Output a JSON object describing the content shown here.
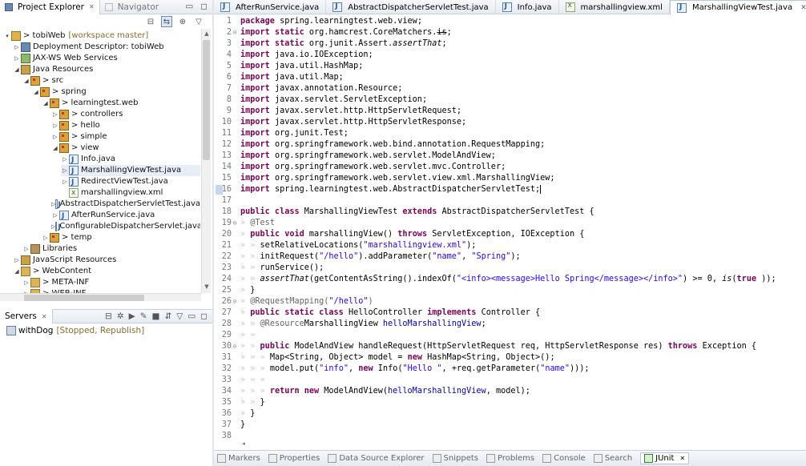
{
  "left_panel": {
    "tabs": [
      {
        "label": "Project Explorer",
        "close": "✕",
        "active": true
      },
      {
        "label": "Navigator",
        "active": false
      }
    ]
  },
  "tree": [
    {
      "depth": 0,
      "arrow": "▾",
      "icon": "proj",
      "label": "> tobiWeb",
      "suffix": "[workspace master]"
    },
    {
      "depth": 1,
      "arrow": "▷",
      "icon": "dd",
      "label": "Deployment Descriptor: tobiWeb"
    },
    {
      "depth": 1,
      "arrow": "▷",
      "icon": "ws",
      "label": "JAX-WS Web Services"
    },
    {
      "depth": 1,
      "arrow": "◢",
      "icon": "src",
      "label": "Java Resources"
    },
    {
      "depth": 2,
      "arrow": "◢",
      "icon": "pkg",
      "label": "> src"
    },
    {
      "depth": 3,
      "arrow": "◢",
      "icon": "pkg",
      "label": "> spring"
    },
    {
      "depth": 4,
      "arrow": "◢",
      "icon": "pkg",
      "label": "> learningtest.web"
    },
    {
      "depth": 5,
      "arrow": "▷",
      "icon": "pkg",
      "label": "> controllers"
    },
    {
      "depth": 5,
      "arrow": "▷",
      "icon": "pkg",
      "label": "> hello"
    },
    {
      "depth": 5,
      "arrow": "▷",
      "icon": "pkg",
      "label": "> simple"
    },
    {
      "depth": 5,
      "arrow": "◢",
      "icon": "pkg",
      "label": "> view"
    },
    {
      "depth": 6,
      "arrow": "▷",
      "icon": "java",
      "label": "Info.java"
    },
    {
      "depth": 6,
      "arrow": "▷",
      "icon": "java",
      "label": "MarshallingViewTest.java",
      "selected": true
    },
    {
      "depth": 6,
      "arrow": "▷",
      "icon": "java",
      "label": "RedirectViewTest.java"
    },
    {
      "depth": 6,
      "arrow": "",
      "icon": "xml",
      "label": "marshallingview.xml"
    },
    {
      "depth": 5,
      "arrow": "▷",
      "icon": "java",
      "label": "AbstractDispatcherServletTest.java"
    },
    {
      "depth": 5,
      "arrow": "▷",
      "icon": "java",
      "label": "AfterRunService.java"
    },
    {
      "depth": 5,
      "arrow": "▷",
      "icon": "java",
      "label": "ConfigurableDispatcherServlet.java"
    },
    {
      "depth": 4,
      "arrow": "▷",
      "icon": "pkg",
      "label": "> temp"
    },
    {
      "depth": 2,
      "arrow": "▷",
      "icon": "lib",
      "label": "Libraries"
    },
    {
      "depth": 1,
      "arrow": "▷",
      "icon": "js",
      "label": "JavaScript Resources"
    },
    {
      "depth": 1,
      "arrow": "◢",
      "icon": "web",
      "label": "> WebContent"
    },
    {
      "depth": 2,
      "arrow": "▷",
      "icon": "web",
      "label": "> META-INF"
    },
    {
      "depth": 2,
      "arrow": "▷",
      "icon": "web",
      "label": "> WEB-INF"
    }
  ],
  "servers_panel": {
    "tab": {
      "label": "Servers",
      "close": "✕"
    },
    "servers": [
      {
        "name": "withDog",
        "status": "[Stopped, Republish]"
      }
    ]
  },
  "editor_tabs": [
    {
      "label": "AfterRunService.java",
      "icon": "java",
      "active": false
    },
    {
      "label": "AbstractDispatcherServletTest.java",
      "icon": "java",
      "active": false
    },
    {
      "label": "Info.java",
      "icon": "java",
      "active": false
    },
    {
      "label": "marshallingview.xml",
      "icon": "xml",
      "active": false
    },
    {
      "label": "MarshallingViewTest.java",
      "icon": "java",
      "active": true,
      "close": "✕"
    }
  ],
  "code": [
    {
      "n": "1",
      "segs": [
        [
          "kw",
          "package"
        ],
        [
          "",
          "spring.learningtest.web.view;"
        ]
      ]
    },
    {
      "n": "2",
      "fold": "⊖",
      "segs": [
        [
          "kw",
          "import static"
        ],
        [
          "",
          "org.hamcrest.CoreMatchers."
        ],
        [
          "strike",
          "is"
        ],
        [
          "",
          ";"
        ]
      ]
    },
    {
      "n": "3",
      "segs": [
        [
          "kw",
          "import static"
        ],
        [
          "",
          "org.junit.Assert."
        ],
        [
          "ital",
          "assertThat"
        ],
        [
          "",
          ";"
        ]
      ]
    },
    {
      "n": "4",
      "segs": [
        [
          "kw",
          "import"
        ],
        [
          "",
          "java.io.IOException;"
        ]
      ]
    },
    {
      "n": "5",
      "segs": [
        [
          "kw",
          "import"
        ],
        [
          "",
          "java.util.HashMap;"
        ]
      ]
    },
    {
      "n": "6",
      "segs": [
        [
          "kw",
          "import"
        ],
        [
          "",
          "java.util.Map;"
        ]
      ]
    },
    {
      "n": "7",
      "segs": [
        [
          "kw",
          "import"
        ],
        [
          "",
          "javax.annotation.Resource;"
        ]
      ]
    },
    {
      "n": "8",
      "segs": [
        [
          "kw",
          "import"
        ],
        [
          "",
          "javax.servlet.ServletException;"
        ]
      ]
    },
    {
      "n": "9",
      "segs": [
        [
          "kw",
          "import"
        ],
        [
          "",
          "javax.servlet.http.HttpServletRequest;"
        ]
      ]
    },
    {
      "n": "10",
      "segs": [
        [
          "kw",
          "import"
        ],
        [
          "",
          "javax.servlet.http.HttpServletResponse;"
        ]
      ]
    },
    {
      "n": "11",
      "segs": [
        [
          "kw",
          "import"
        ],
        [
          "",
          "org.junit.Test;"
        ]
      ]
    },
    {
      "n": "12",
      "segs": [
        [
          "kw",
          "import"
        ],
        [
          "",
          "org.springframework.web.bind.annotation.RequestMapping;"
        ]
      ]
    },
    {
      "n": "13",
      "segs": [
        [
          "kw",
          "import"
        ],
        [
          "",
          "org.springframework.web.servlet.ModelAndView;"
        ]
      ]
    },
    {
      "n": "14",
      "segs": [
        [
          "kw",
          "import"
        ],
        [
          "",
          "org.springframework.web.servlet.mvc.Controller;"
        ]
      ]
    },
    {
      "n": "15",
      "segs": [
        [
          "kw",
          "import"
        ],
        [
          "",
          "org.springframework.web.servlet.view.xml.MarshallingView;"
        ]
      ]
    },
    {
      "n": "16",
      "marker": true,
      "segs": [
        [
          "kw",
          "import"
        ],
        [
          "",
          "spring.learningtest.web.AbstractDispatcherServletTest;"
        ]
      ]
    },
    {
      "n": "17",
      "segs": []
    },
    {
      "n": "18",
      "segs": [
        [
          "kw",
          "public class"
        ],
        [
          "",
          "MarshallingViewTest "
        ],
        [
          "kw",
          "extends"
        ],
        [
          "",
          "AbstractDispatcherServletTest {"
        ]
      ]
    },
    {
      "n": "19",
      "fold": "⊖",
      "segs": [
        [
          "tab",
          "» "
        ],
        [
          "ann",
          "@Test"
        ]
      ]
    },
    {
      "n": "20",
      "segs": [
        [
          "tab",
          "» "
        ],
        [
          "kw",
          "public void"
        ],
        [
          "",
          "marshallingView() "
        ],
        [
          "kw",
          "throws"
        ],
        [
          "",
          "ServletException, IOException {"
        ]
      ]
    },
    {
      "n": "21",
      "segs": [
        [
          "tab",
          "» » "
        ],
        [
          "",
          "setRelativeLocations("
        ],
        [
          "str",
          "\"marshallingview.xml\""
        ],
        [
          "",
          ");"
        ]
      ]
    },
    {
      "n": "22",
      "segs": [
        [
          "tab",
          "» » "
        ],
        [
          "",
          "initRequest("
        ],
        [
          "str",
          "\"/hello\""
        ],
        [
          "",
          ").addParameter("
        ],
        [
          "str",
          "\"name\""
        ],
        [
          "",
          ", "
        ],
        [
          "str",
          "\"Spring\""
        ],
        [
          "",
          ");"
        ]
      ]
    },
    {
      "n": "23",
      "segs": [
        [
          "tab",
          "» » "
        ],
        [
          "",
          "runService();"
        ]
      ]
    },
    {
      "n": "24",
      "segs": [
        [
          "tab",
          "» » "
        ],
        [
          "ital",
          "assertThat"
        ],
        [
          "",
          "(getContentAsString().indexOf("
        ],
        [
          "str",
          "\"<info><message>Hello Spring</message></info>\""
        ],
        [
          "",
          ") >= 0, "
        ],
        [
          "ital",
          "is"
        ],
        [
          "",
          "("
        ],
        [
          "kw",
          "true"
        ],
        [
          "",
          "));"
        ]
      ]
    },
    {
      "n": "25",
      "segs": [
        [
          "tab",
          "» "
        ],
        [
          "",
          "}"
        ]
      ]
    },
    {
      "n": "26",
      "fold": "⊖",
      "segs": [
        [
          "tab",
          "» "
        ],
        [
          "ann",
          "@RequestMapping("
        ],
        [
          "str",
          "\"/hello\""
        ],
        [
          "ann",
          ")"
        ]
      ]
    },
    {
      "n": "27",
      "segs": [
        [
          "tab",
          "» "
        ],
        [
          "kw",
          "public static class"
        ],
        [
          "",
          "HelloController "
        ],
        [
          "kw",
          "implements"
        ],
        [
          "",
          "Controller {"
        ]
      ]
    },
    {
      "n": "28",
      "segs": [
        [
          "tab",
          "» » "
        ],
        [
          "ann",
          "@Resource"
        ],
        [
          "",
          "MarshallingView "
        ],
        [
          "fld",
          "helloMarshallingView"
        ],
        [
          "",
          ";"
        ]
      ]
    },
    {
      "n": "29",
      "segs": [
        [
          "tab",
          "» »"
        ]
      ]
    },
    {
      "n": "30",
      "fold": "⊖",
      "pre": "△",
      "segs": [
        [
          "tab",
          "» » "
        ],
        [
          "kw",
          "public"
        ],
        [
          "",
          "ModelAndView handleRequest(HttpServletRequest req, HttpServletResponse res) "
        ],
        [
          "kw",
          "throws"
        ],
        [
          "",
          "Exception {"
        ]
      ]
    },
    {
      "n": "31",
      "segs": [
        [
          "tab",
          "» » » "
        ],
        [
          "",
          "Map<String, Object> model = "
        ],
        [
          "kw",
          "new"
        ],
        [
          "",
          "HashMap<String, Object>();"
        ]
      ]
    },
    {
      "n": "32",
      "segs": [
        [
          "tab",
          "» » » "
        ],
        [
          "",
          "model.put("
        ],
        [
          "str",
          "\"info\""
        ],
        [
          "",
          ", "
        ],
        [
          "kw",
          "new"
        ],
        [
          "",
          "Info("
        ],
        [
          "str",
          "\"Hello \""
        ],
        [
          "",
          ", +req.getParameter("
        ],
        [
          "str",
          "\"name\""
        ],
        [
          "",
          ")));"
        ]
      ]
    },
    {
      "n": "33",
      "segs": [
        [
          "tab",
          "» » »"
        ]
      ]
    },
    {
      "n": "34",
      "segs": [
        [
          "tab",
          "» » » "
        ],
        [
          "kw",
          "return new"
        ],
        [
          "",
          "ModelAndView("
        ],
        [
          "fld",
          "helloMarshallingView"
        ],
        [
          "",
          ", model);"
        ]
      ]
    },
    {
      "n": "35",
      "segs": [
        [
          "tab",
          "» » "
        ],
        [
          "",
          "}"
        ]
      ]
    },
    {
      "n": "36",
      "segs": [
        [
          "tab",
          "» "
        ],
        [
          "",
          "}"
        ]
      ]
    },
    {
      "n": "37",
      "segs": [
        [
          "",
          "}"
        ]
      ]
    },
    {
      "n": "38",
      "segs": []
    }
  ],
  "bottom_tabs": [
    {
      "label": "Markers",
      "icon": "markers"
    },
    {
      "label": "Properties",
      "icon": "properties"
    },
    {
      "label": "Data Source Explorer",
      "icon": "datasource"
    },
    {
      "label": "Snippets",
      "icon": "snippets"
    },
    {
      "label": "Problems",
      "icon": "problems"
    },
    {
      "label": "Console",
      "icon": "console"
    },
    {
      "label": "Search",
      "icon": "search"
    },
    {
      "label": "JUnit",
      "icon": "junit",
      "active": true,
      "close": "✕"
    }
  ]
}
